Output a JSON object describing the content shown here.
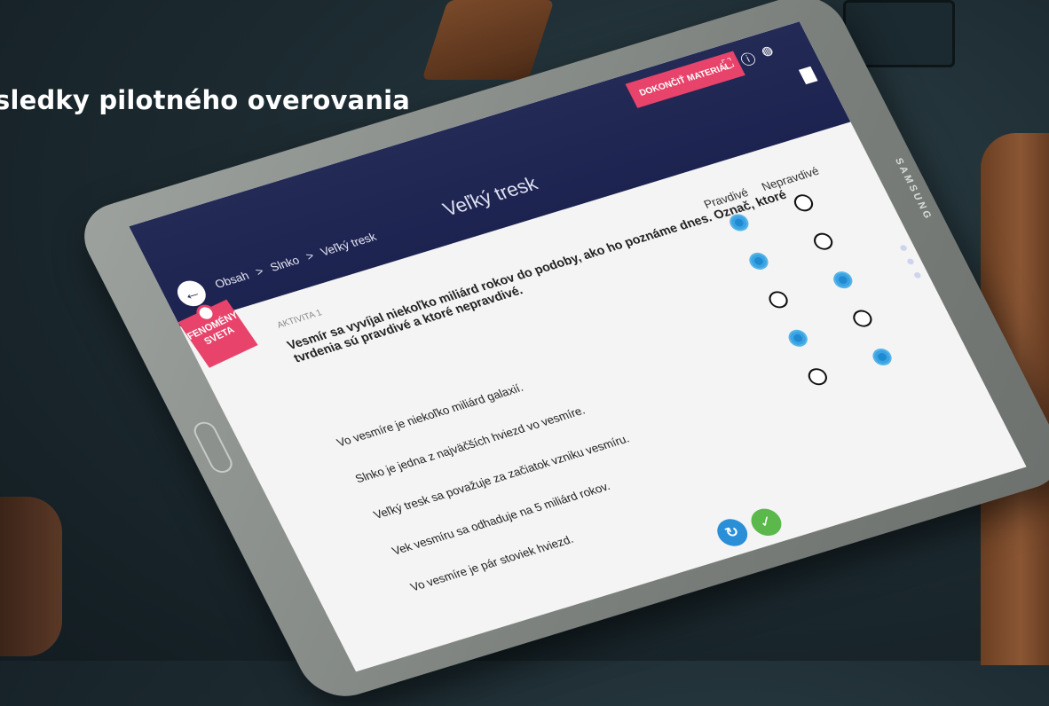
{
  "headline": "sledky pilotného overovania",
  "tablet": {
    "brand": "SAMSUNG",
    "app": {
      "breadcrumb": [
        "Obsah",
        "Slnko",
        "Veľký tresk"
      ],
      "breadcrumb_sep": ">",
      "title": "Veľký tresk",
      "finish_button": "DOKONČIŤ MATERIÁL",
      "logo_lines": [
        "FENOMÉNY",
        "SVETA"
      ],
      "activity_label": "AKTIVITA 1",
      "question": "Vesmír sa vyvíjal niekoľko miliárd rokov do podoby, ako ho poznáme dnes. Označ, ktoré tvrdenia sú pravdivé a ktoré nepravdivé.",
      "columns": [
        "Pravdivé",
        "Nepravdivé"
      ],
      "statements": [
        {
          "text": "Vo vesmíre je niekoľko miliárd galaxií.",
          "true_selected": true,
          "false_selected": false
        },
        {
          "text": "Slnko je jedna z najväčších hviezd vo vesmíre.",
          "true_selected": true,
          "false_selected": false
        },
        {
          "text": "Veľký tresk sa považuje za začiatok vzniku vesmíru.",
          "true_selected": false,
          "false_selected": true
        },
        {
          "text": "Vek vesmíru sa odhaduje na 5 miliárd rokov.",
          "true_selected": true,
          "false_selected": false
        },
        {
          "text": "Vo vesmíre je pár stoviek hviezd.",
          "true_selected": false,
          "false_selected": true
        }
      ],
      "icons": {
        "back": "arrow-left-icon",
        "reset": "refresh-icon",
        "check": "check-icon",
        "bookmark": "bookmark-icon"
      },
      "colors": {
        "topbar": "#232a55",
        "accent_pink": "#e8436a",
        "radio_on": "#2b8fd7",
        "check_green": "#5ab94a"
      }
    }
  }
}
